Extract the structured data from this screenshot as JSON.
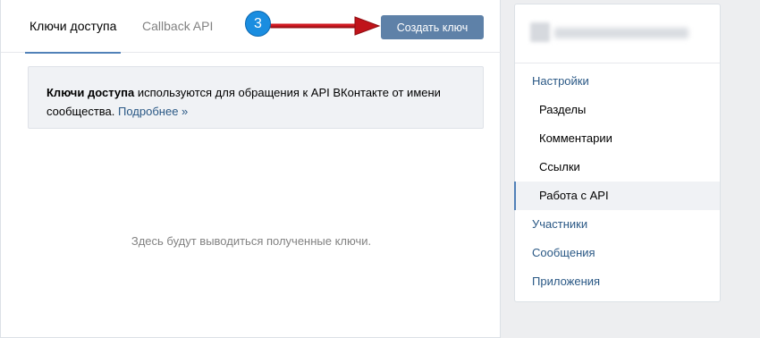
{
  "tabs": [
    {
      "label": "Ключи доступа",
      "active": true
    },
    {
      "label": "Callback API",
      "active": false
    }
  ],
  "create_button": "Создать ключ",
  "step_badge": "3",
  "info": {
    "bold": "Ключи доступа",
    "text": " используются для обращения к API ВКонтакте от имени сообщества. ",
    "link": "Подробнее »"
  },
  "empty_text": "Здесь будут выводиться полученные ключи.",
  "sidebar": {
    "items": [
      {
        "label": "Настройки",
        "level": "top"
      },
      {
        "label": "Разделы",
        "level": "sub"
      },
      {
        "label": "Комментарии",
        "level": "sub"
      },
      {
        "label": "Ссылки",
        "level": "sub"
      },
      {
        "label": "Работа с API",
        "level": "sub",
        "selected": true
      },
      {
        "label": "Участники",
        "level": "top"
      },
      {
        "label": "Сообщения",
        "level": "top"
      },
      {
        "label": "Приложения",
        "level": "top"
      }
    ]
  },
  "colors": {
    "accent": "#5181b8",
    "button": "#5e81a8",
    "arrow": "#c0131a",
    "badge": "#1a8de0"
  }
}
